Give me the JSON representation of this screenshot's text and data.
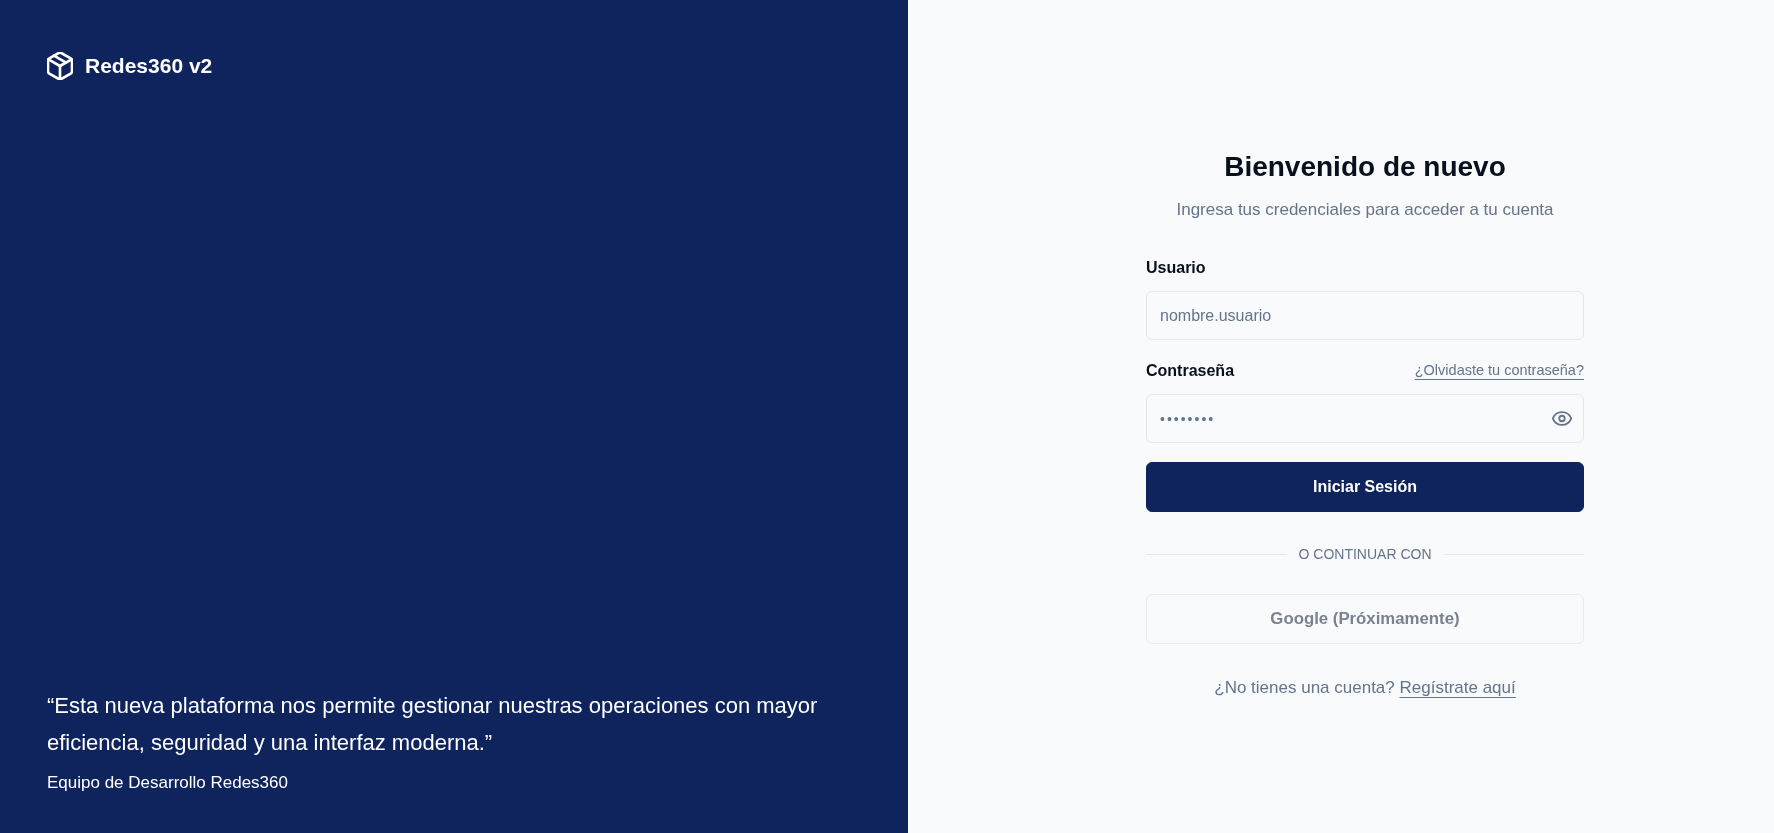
{
  "brand": {
    "name": "Redes360 v2"
  },
  "testimonial": {
    "quote": "“Esta nueva plataforma nos permite gestionar nuestras operaciones con mayor eficiencia, seguridad y una interfaz moderna.”",
    "author": "Equipo de Desarrollo Redes360"
  },
  "login": {
    "title": "Bienvenido de nuevo",
    "subtitle": "Ingresa tus credenciales para acceder a tu cuenta",
    "fields": [
      {
        "kind": "text",
        "label": "Usuario",
        "placeholder": "nombre.usuario"
      },
      {
        "kind": "password",
        "label": "Contraseña",
        "link": "¿Olvidaste tu contraseña?",
        "value": "••••••••"
      }
    ],
    "submit": "Iniciar Sesión",
    "divider": "O CONTINUAR CON",
    "social_button": {
      "label": "Google (Próximamente)",
      "disabled": true
    },
    "register": {
      "prompt": "¿No tienes una cuenta?",
      "link": "Regístrate aquí"
    }
  }
}
